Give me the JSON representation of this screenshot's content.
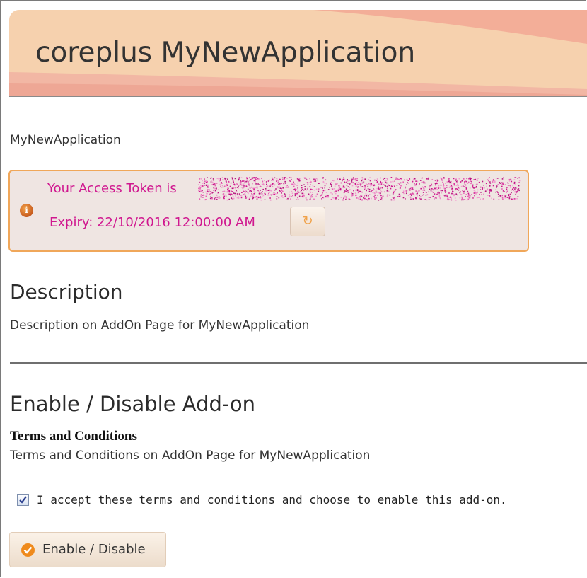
{
  "banner": {
    "title": "coreplus MyNewApplication"
  },
  "app": {
    "name": "MyNewApplication"
  },
  "token": {
    "prefix": "Your Access Token is",
    "expiry": "Expiry: 22/10/2016 12:00:00 AM"
  },
  "description": {
    "heading": "Description",
    "text": "Description on AddOn Page for MyNewApplication"
  },
  "enable_section": {
    "heading": "Enable / Disable Add-on",
    "terms_title": "Terms and Conditions",
    "terms_text": "Terms and Conditions on AddOn Page for MyNewApplication",
    "accept_label": "I accept these terms and conditions and choose to enable this add-on.",
    "accepted": true,
    "button_label": "Enable / Disable"
  },
  "colors": {
    "banner": "#f6d1ae",
    "token_text": "#d0178f",
    "token_border": "#f0a75a",
    "accent": "#ef8a1c"
  },
  "icons": {
    "info": "info-icon",
    "refresh": "refresh-icon",
    "checkmark": "check-circle-icon"
  }
}
